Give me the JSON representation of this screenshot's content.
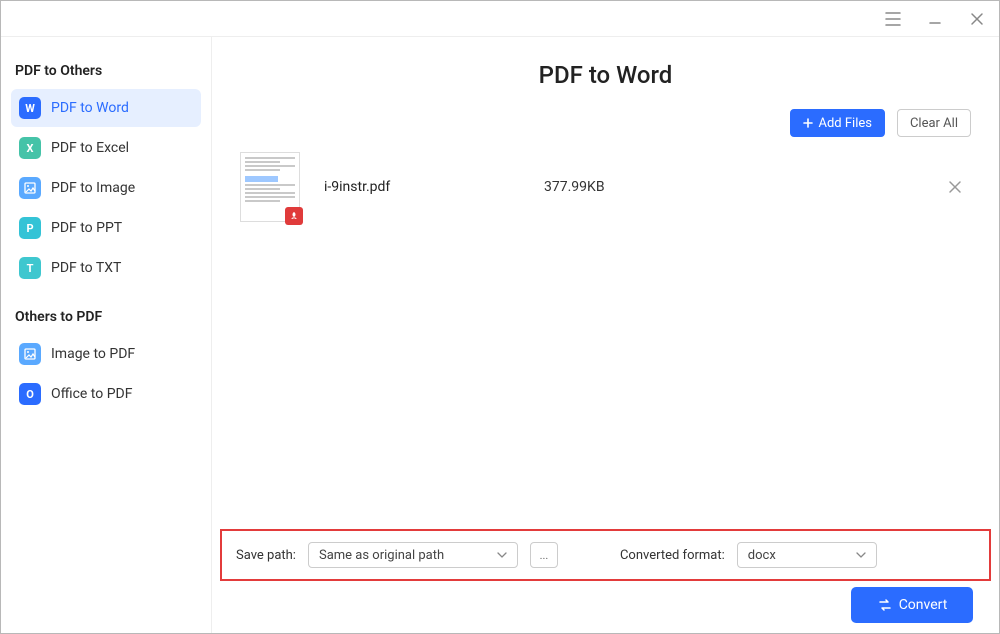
{
  "sidebar": {
    "section1_title": "PDF to Others",
    "section2_title": "Others to PDF",
    "items1": [
      {
        "label": "PDF to Word",
        "icon_letter": "W"
      },
      {
        "label": "PDF to Excel",
        "icon_letter": "X"
      },
      {
        "label": "PDF to Image",
        "icon_letter": ""
      },
      {
        "label": "PDF to PPT",
        "icon_letter": "P"
      },
      {
        "label": "PDF to TXT",
        "icon_letter": "T"
      }
    ],
    "items2": [
      {
        "label": "Image to PDF",
        "icon_letter": ""
      },
      {
        "label": "Office to PDF",
        "icon_letter": "O"
      }
    ]
  },
  "main": {
    "title": "PDF to Word",
    "add_files_label": "Add Files",
    "clear_all_label": "Clear All",
    "files": [
      {
        "name": "i-9instr.pdf",
        "size": "377.99KB"
      }
    ]
  },
  "bottom": {
    "save_path_label": "Save path:",
    "save_path_value": "Same as original path",
    "browse_label": "...",
    "converted_format_label": "Converted format:",
    "converted_format_value": "docx",
    "convert_label": "Convert"
  }
}
